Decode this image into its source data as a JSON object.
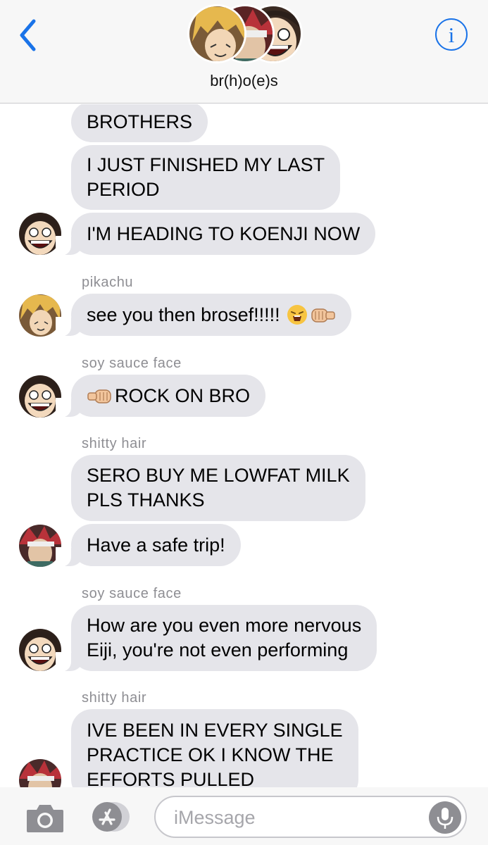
{
  "header": {
    "group_name": "br(h)o(e)s",
    "back_icon": "chevron-left-icon",
    "info_icon": "info-icon",
    "info_glyph": "i",
    "accent_color": "#1a73e8"
  },
  "messages": [
    {
      "sender": "",
      "text": "BROTHERS"
    },
    {
      "sender": "",
      "text": "I JUST FINISHED MY LAST\nPERIOD"
    },
    {
      "sender": "",
      "text": "I'M HEADING TO KOENJI NOW",
      "avatar": "sero-avatar"
    },
    {
      "sender": "pikachu",
      "text": "see you then brosef!!!!! ",
      "emoji": [
        "weary-face-emoji",
        "left-facing-fist-emoji"
      ],
      "avatar": "kaminari-avatar"
    },
    {
      "sender": "soy sauce face",
      "text": "ROCK ON BRO",
      "emoji": [
        "right-facing-fist-emoji"
      ],
      "avatar": "sero-avatar"
    },
    {
      "sender": "shitty hair",
      "text": "SERO BUY ME LOWFAT MILK\nPLS THANKS"
    },
    {
      "sender": "",
      "text": "Have a safe trip!",
      "avatar": "kirishima-avatar"
    },
    {
      "sender": "soy sauce face",
      "text": "How are you even more nervous\nEiji, you're not even performing",
      "avatar": "sero-avatar"
    },
    {
      "sender": "shitty hair",
      "text": "IVE BEEN IN EVERY SINGLE\nPRACTICE OK I KNOW THE\nEFFORTS PULLED",
      "avatar": "kirishima-avatar"
    }
  ],
  "input": {
    "placeholder": "iMessage",
    "camera_icon": "camera-icon",
    "apps_icon": "app-store-icon",
    "mic_icon": "microphone-icon"
  },
  "colors": {
    "bubble_gray": "#e5e5ea",
    "sender_gray": "#8e8e93",
    "header_bg": "#f7f7f7"
  }
}
